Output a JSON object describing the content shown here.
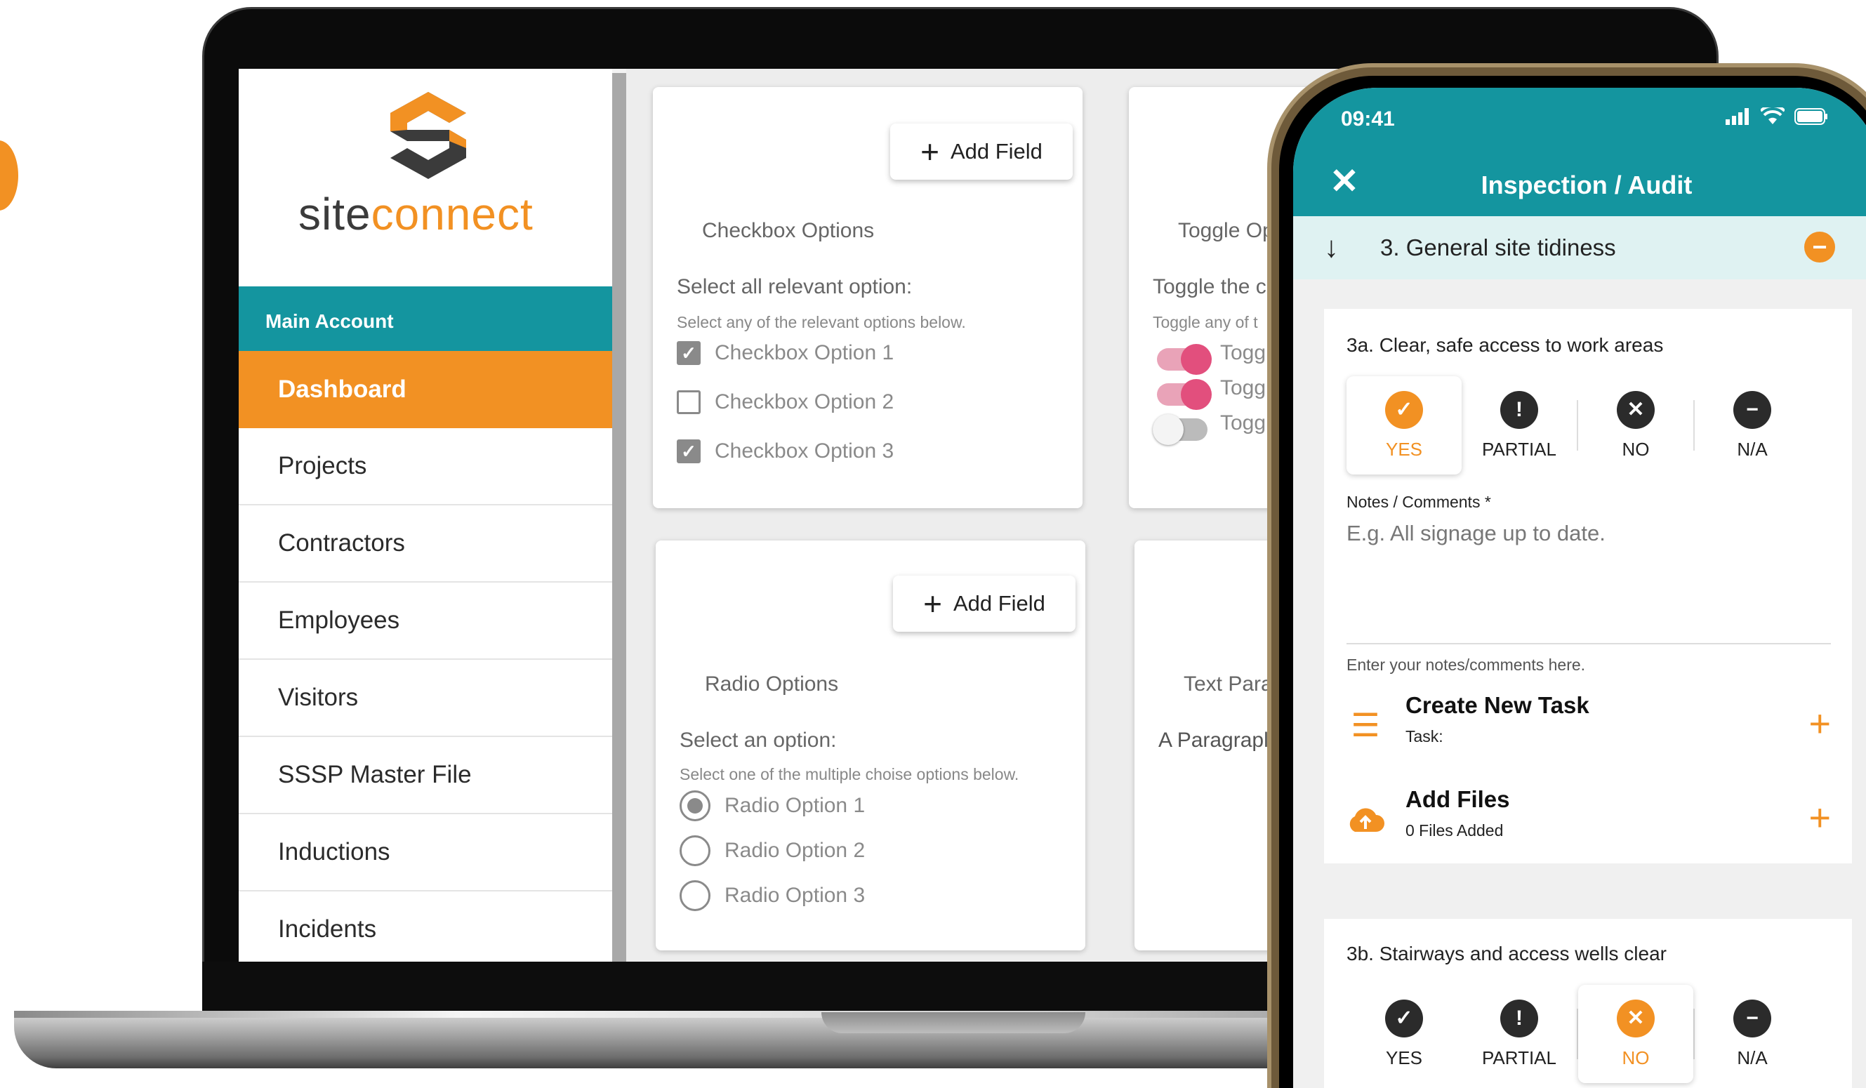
{
  "colors": {
    "brand_orange": "#F29123",
    "teal": "#14959F",
    "dark": "#2B2B2B",
    "toggle_pink": "#E24F7D"
  },
  "sidebar": {
    "brand_prefix": "site",
    "brand_suffix": "connect",
    "account_label": "Main Account",
    "items": [
      {
        "label": "Dashboard",
        "active": true
      },
      {
        "label": "Projects"
      },
      {
        "label": "Contractors"
      },
      {
        "label": "Employees"
      },
      {
        "label": "Visitors"
      },
      {
        "label": "SSSP Master File"
      },
      {
        "label": "Inductions"
      },
      {
        "label": "Incidents"
      }
    ]
  },
  "builder": {
    "add_field_label": "Add Field",
    "checkbox_card": {
      "title": "Checkbox Options",
      "prompt": "Select all relevant option:",
      "hint": "Select any of the relevant options below.",
      "options": [
        {
          "label": "Checkbox Option 1",
          "checked": true
        },
        {
          "label": "Checkbox Option 2",
          "checked": false
        },
        {
          "label": "Checkbox Option 3",
          "checked": true
        }
      ]
    },
    "toggle_card": {
      "title": "Toggle Op",
      "prompt": "Toggle the c",
      "hint": "Toggle any of t",
      "options": [
        {
          "label": "Togg",
          "on": true
        },
        {
          "label": "Togg",
          "on": true
        },
        {
          "label": "Togg",
          "on": false
        }
      ]
    },
    "radio_card": {
      "title": "Radio Options",
      "prompt": "Select an option:",
      "hint": "Select one of the multiple choise options below.",
      "options": [
        {
          "label": "Radio Option 1",
          "checked": true
        },
        {
          "label": "Radio Option 2",
          "checked": false
        },
        {
          "label": "Radio Option 3",
          "checked": false
        }
      ]
    },
    "text_card": {
      "title": "Text Para",
      "value": "A Paragrapl"
    }
  },
  "phone": {
    "time": "09:41",
    "title": "Inspection / Audit",
    "section": "3. General site tidiness",
    "answer_labels": [
      "YES",
      "PARTIAL",
      "NO",
      "N/A"
    ],
    "q1": {
      "title": "3a. Clear, safe access to work areas",
      "selected": "YES",
      "notes_label": "Notes / Comments *",
      "notes_placeholder": "E.g. All signage up to date.",
      "notes_help": "Enter your notes/comments here.",
      "task_title": "Create New Task",
      "task_sub": "Task:",
      "files_title": "Add Files",
      "files_sub": "0 Files Added"
    },
    "q2": {
      "title": "3b. Stairways and access wells clear",
      "selected": "NO"
    }
  }
}
